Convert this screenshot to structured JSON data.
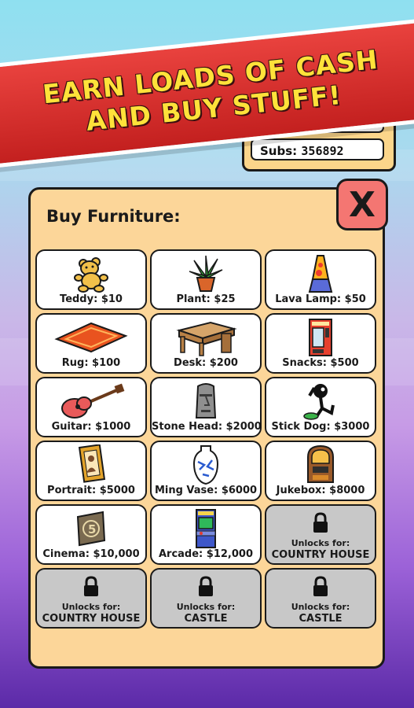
{
  "banner": {
    "line1": "EARN LOADS OF CASH",
    "line2": "AND BUY STUFF!"
  },
  "stats": {
    "subs_label": "Subs:",
    "subs_value": "356892"
  },
  "dialog": {
    "title": "Buy Furniture:",
    "close_label": "X",
    "items": [
      {
        "label": "Teddy: $10",
        "icon": "teddy-bear-icon"
      },
      {
        "label": "Plant: $25",
        "icon": "plant-icon"
      },
      {
        "label": "Lava Lamp: $50",
        "icon": "lava-lamp-icon"
      },
      {
        "label": "Rug: $100",
        "icon": "rug-icon"
      },
      {
        "label": "Desk: $200",
        "icon": "desk-icon"
      },
      {
        "label": "Snacks: $500",
        "icon": "snack-machine-icon"
      },
      {
        "label": "Guitar: $1000",
        "icon": "guitar-icon"
      },
      {
        "label": "Stone Head: $2000",
        "icon": "stone-head-icon"
      },
      {
        "label": "Stick Dog: $3000",
        "icon": "stick-dog-icon"
      },
      {
        "label": "Portrait: $5000",
        "icon": "portrait-icon"
      },
      {
        "label": "Ming Vase: $6000",
        "icon": "vase-icon"
      },
      {
        "label": "Jukebox: $8000",
        "icon": "jukebox-icon"
      },
      {
        "label": "Cinema: $10,000",
        "icon": "cinema-icon"
      },
      {
        "label": "Arcade: $12,000",
        "icon": "arcade-icon"
      }
    ],
    "locked": [
      {
        "line1": "Unlocks for:",
        "line2": "COUNTRY HOUSE"
      },
      {
        "line1": "Unlocks for:",
        "line2": "COUNTRY HOUSE"
      },
      {
        "line1": "Unlocks for:",
        "line2": "CASTLE"
      },
      {
        "line1": "Unlocks for:",
        "line2": "CASTLE"
      }
    ]
  },
  "colors": {
    "banner": "#d8302c",
    "banner_text": "#ffe23a",
    "panel": "#fcd699",
    "close": "#f47672",
    "locked": "#c8c8c8"
  }
}
